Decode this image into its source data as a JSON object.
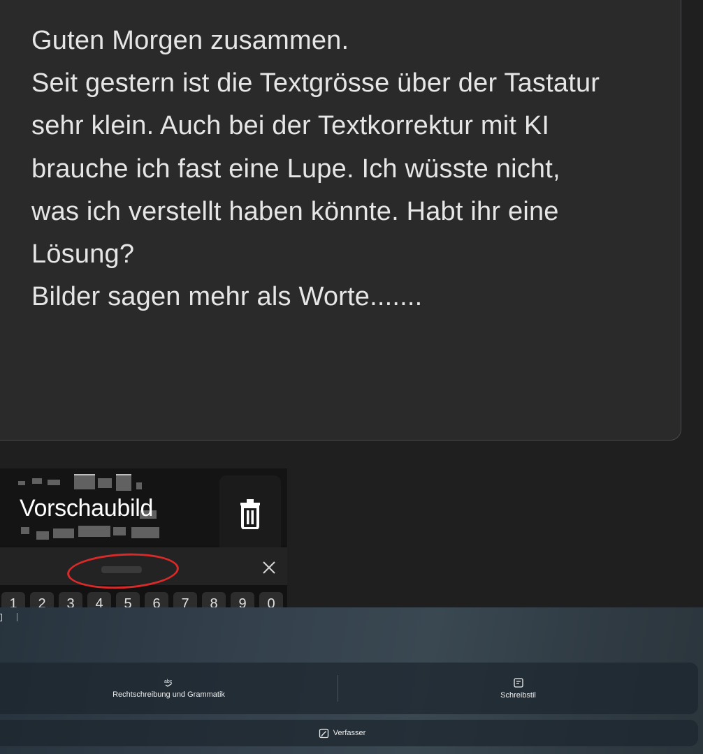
{
  "message": {
    "lines": [
      "Guten Morgen zusammen.",
      "Seit gestern ist die Textgrösse über der Tastatur",
      "sehr klein. Auch bei der Textkorrektur mit KI",
      "brauche ich fast eine Lupe. Ich wüsste nicht,",
      "was ich verstellt haben könnte. Habt ihr eine",
      "Lösung?",
      "Bilder sagen mehr als Worte......."
    ]
  },
  "attachment": {
    "preview_label": "Vorschaubild",
    "delete_icon": "trash-icon",
    "keys": [
      "1",
      "2",
      "3",
      "4",
      "5",
      "6",
      "7",
      "8",
      "9",
      "0"
    ]
  },
  "keyboard_panel": {
    "tools": [
      {
        "label": "Rechtschreibung und Grammatik",
        "icon": "spellcheck-icon"
      },
      {
        "label": "Schreibstil",
        "icon": "writing-style-icon"
      }
    ],
    "compose": {
      "label": "Verfasser",
      "icon": "compose-icon"
    }
  },
  "colors": {
    "background": "#1f1f1f",
    "card": "#2a2a2b",
    "text": "#e6e6e6",
    "highlight_circle": "#d92a2a",
    "panel": "#34414d"
  }
}
